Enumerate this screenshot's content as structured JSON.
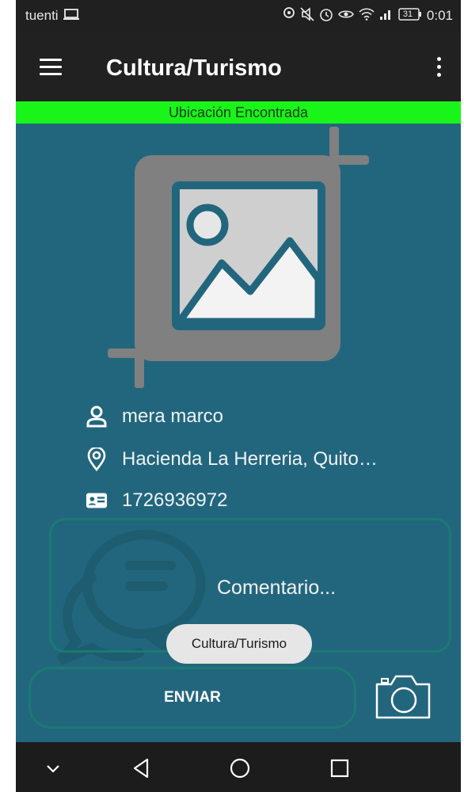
{
  "status_bar": {
    "carrier": "tuenti",
    "battery": "31",
    "time": "0:01"
  },
  "app_bar": {
    "title": "Cultura/Turismo",
    "menu_icon": "hamburger-menu-icon",
    "overflow_icon": "more-vert-icon"
  },
  "location_banner": {
    "text": "Ubicación Encontrada",
    "color": "#19f519"
  },
  "image_placeholder": {
    "icon": "image-crop-icon"
  },
  "info": {
    "name": "mera marco",
    "address": "Hacienda La Herreria, Quito…",
    "id_number": "1726936972",
    "person_icon": "person-icon",
    "location_icon": "location-pin-icon",
    "id_icon": "id-card-icon"
  },
  "comment": {
    "placeholder": "Comentario...",
    "icon": "chat-bubbles-icon"
  },
  "actions": {
    "send_label": "ENVIAR",
    "camera_icon": "camera-icon"
  },
  "toast": {
    "text": "Cultura/Turismo"
  },
  "nav_bar": {
    "icons": [
      "chevron-down-icon",
      "back-triangle-icon",
      "home-circle-icon",
      "recents-square-icon"
    ]
  },
  "colors": {
    "background": "#22667e",
    "app_bar": "#212121",
    "accent_border": "#1b7a72"
  }
}
